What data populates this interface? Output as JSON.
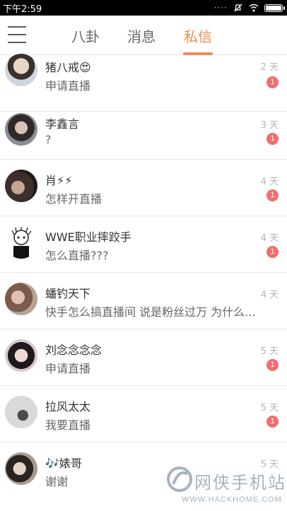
{
  "status_bar": {
    "time": "下午2:59",
    "signal_dots": "····"
  },
  "nav": {
    "tabs": [
      {
        "label": "八卦",
        "active": false
      },
      {
        "label": "消息",
        "active": false
      },
      {
        "label": "私信",
        "active": true
      }
    ],
    "accent": "#f5894d"
  },
  "messages": [
    {
      "name": "猪八戒😍",
      "text": "申请直播",
      "time": "2 天",
      "unread": "1"
    },
    {
      "name": "李鑫言",
      "text": "?",
      "time": "3 天",
      "unread": "1"
    },
    {
      "name": "肖⚡⚡",
      "text": "怎样开直播",
      "time": "4 天",
      "unread": "1"
    },
    {
      "name": "WWE职业摔跤手",
      "text": "怎么直播???",
      "time": "4 天",
      "unread": "1"
    },
    {
      "name": "蟠钓天下",
      "text": "快手怎么搞直播间  说是粉丝过万  为什么...",
      "time": "4 天",
      "unread": ""
    },
    {
      "name": "刘念念念念",
      "text": "申请直播",
      "time": "5 天",
      "unread": "1"
    },
    {
      "name": "拉风太太",
      "text": "我要直播",
      "time": "5 天",
      "unread": "1"
    },
    {
      "name": "🎶婊哥",
      "text": "谢谢",
      "time": "5 天",
      "unread": ""
    }
  ],
  "watermark": {
    "text": "网侠手机站",
    "url": "WWW.HACKHOME.COM"
  }
}
